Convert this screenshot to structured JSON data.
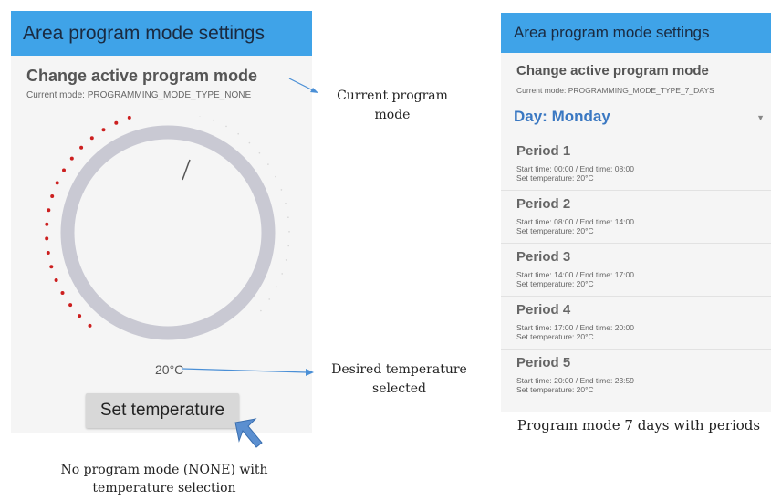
{
  "left_screen": {
    "appbar_title": "Area program mode settings",
    "heading": "Change active program mode",
    "current_mode": "Current mode: PROGRAMMING_MODE_TYPE_NONE",
    "temperature_value": "20°C",
    "set_button_label": "Set temperature"
  },
  "right_screen": {
    "appbar_title": "Area program mode settings",
    "heading": "Change active program mode",
    "current_mode": "Current mode: PROGRAMMING_MODE_TYPE_7_DAYS",
    "day_label": "Day:  Monday",
    "day_caret": "▼",
    "periods": [
      {
        "title": "Period 1",
        "time": "Start time: 00:00 / End time: 08:00",
        "temp": "Set temperature: 20°C"
      },
      {
        "title": "Period 2",
        "time": "Start time: 08:00 / End time: 14:00",
        "temp": "Set temperature: 20°C"
      },
      {
        "title": "Period 3",
        "time": "Start time: 14:00 / End time: 17:00",
        "temp": "Set temperature: 20°C"
      },
      {
        "title": "Period 4",
        "time": "Start time: 17:00 / End time: 20:00",
        "temp": "Set temperature: 20°C"
      },
      {
        "title": "Period 5",
        "time": "Start time: 20:00 / End time: 23:59",
        "temp": "Set temperature: 20°C"
      }
    ]
  },
  "annotations": {
    "current_program_mode": "Current program mode",
    "desired_temperature": "Desired temperature selected",
    "no_program_mode": "No program mode (NONE) with temperature selection",
    "seven_days": "Program mode 7 days with periods"
  },
  "colors": {
    "appbar": "#3fa3e8",
    "dial_ring": "#c9c9d3",
    "dots_active": "#cc1f1f",
    "day_label": "#3a78c2",
    "arrow": "#4a8fd6"
  }
}
